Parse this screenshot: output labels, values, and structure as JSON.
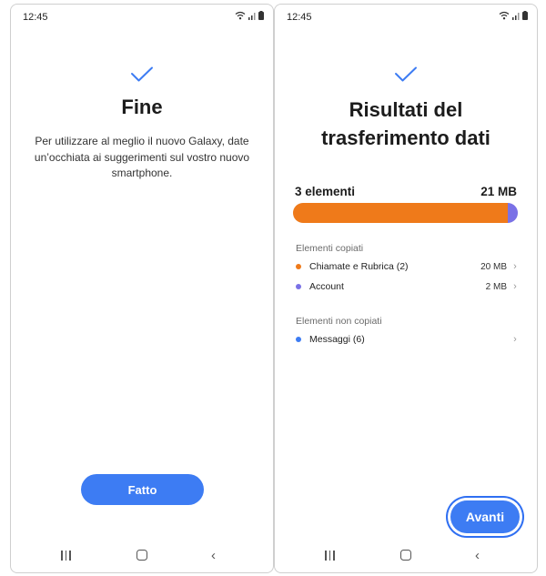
{
  "status_bar": {
    "time": "12:45"
  },
  "left_screen": {
    "title": "Fine",
    "description": "Per utilizzare al meglio il nuovo Galaxy, date un’occhiata ai suggerimenti sul vostro nuovo smartphone.",
    "done_button_label": "Fatto"
  },
  "right_screen": {
    "title_line1": "Risultati del",
    "title_line2": "trasferimento dati",
    "summary": {
      "count_label": "3 elementi",
      "total_size": "21 MB"
    },
    "progress": {
      "orange_fraction": 0.955,
      "purple_fraction": 0.045
    },
    "copied_section": {
      "header": "Elementi copiati",
      "items": [
        {
          "label": "Chiamate e Rubrica (2)",
          "size": "20 MB",
          "color": "#ef7a1a"
        },
        {
          "label": "Account",
          "size": "2 MB",
          "color": "#7a71e6"
        }
      ]
    },
    "not_copied_section": {
      "header": "Elementi non copiati",
      "items": [
        {
          "label": "Messaggi (6)",
          "size": "",
          "color": "#3d7cf3"
        }
      ]
    },
    "next_button_label": "Avanti"
  },
  "colors": {
    "accent": "#3d7cf3",
    "orange": "#ef7a1a",
    "purple": "#7a71e6"
  },
  "icons": [
    "wifi-icon",
    "signal-icon",
    "battery-icon",
    "checkmark-icon",
    "chevron-right-icon",
    "nav-recent-icon",
    "nav-home-icon",
    "nav-back-icon"
  ]
}
